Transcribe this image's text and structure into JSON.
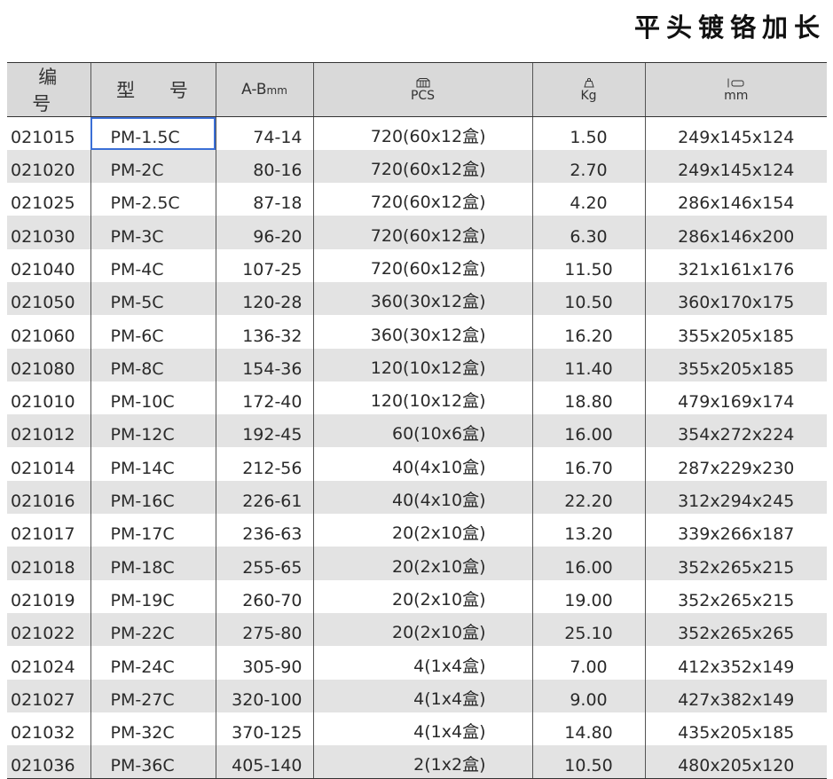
{
  "title": "平头镀铬加长",
  "headers": {
    "code": "编 号",
    "model": "型 号",
    "ab": "A-B",
    "ab_unit": "mm",
    "pcs_icon": "box-icon",
    "pcs": "PCS",
    "kg_icon": "weight-icon",
    "kg": "Kg",
    "mm_icon": "carton-dimension-icon",
    "mm": "mm"
  },
  "rows": [
    {
      "code": "021015",
      "model": "PM-1.5C",
      "ab": "74-14",
      "pcs": "720(60x12盒)",
      "kg": "1.50",
      "dim": "249x145x124"
    },
    {
      "code": "021020",
      "model": "PM-2C",
      "ab": "80-16",
      "pcs": "720(60x12盒)",
      "kg": "2.70",
      "dim": "249x145x124"
    },
    {
      "code": "021025",
      "model": "PM-2.5C",
      "ab": "87-18",
      "pcs": "720(60x12盒)",
      "kg": "4.20",
      "dim": "286x146x154"
    },
    {
      "code": "021030",
      "model": "PM-3C",
      "ab": "96-20",
      "pcs": "720(60x12盒)",
      "kg": "6.30",
      "dim": "286x146x200"
    },
    {
      "code": "021040",
      "model": "PM-4C",
      "ab": "107-25",
      "pcs": "720(60x12盒)",
      "kg": "11.50",
      "dim": "321x161x176"
    },
    {
      "code": "021050",
      "model": "PM-5C",
      "ab": "120-28",
      "pcs": "360(30x12盒)",
      "kg": "10.50",
      "dim": "360x170x175"
    },
    {
      "code": "021060",
      "model": "PM-6C",
      "ab": "136-32",
      "pcs": "360(30x12盒)",
      "kg": "16.20",
      "dim": "355x205x185"
    },
    {
      "code": "021080",
      "model": "PM-8C",
      "ab": "154-36",
      "pcs": "120(10x12盒)",
      "kg": "11.40",
      "dim": "355x205x185"
    },
    {
      "code": "021010",
      "model": "PM-10C",
      "ab": "172-40",
      "pcs": "120(10x12盒)",
      "kg": "18.80",
      "dim": "479x169x174"
    },
    {
      "code": "021012",
      "model": "PM-12C",
      "ab": "192-45",
      "pcs": "60(10x6盒)",
      "kg": "16.00",
      "dim": "354x272x224"
    },
    {
      "code": "021014",
      "model": "PM-14C",
      "ab": "212-56",
      "pcs": "40(4x10盒)",
      "kg": "16.70",
      "dim": "287x229x230"
    },
    {
      "code": "021016",
      "model": "PM-16C",
      "ab": "226-61",
      "pcs": "40(4x10盒)",
      "kg": "22.20",
      "dim": "312x294x245"
    },
    {
      "code": "021017",
      "model": "PM-17C",
      "ab": "236-63",
      "pcs": "20(2x10盒)",
      "kg": "13.20",
      "dim": "339x266x187"
    },
    {
      "code": "021018",
      "model": "PM-18C",
      "ab": "255-65",
      "pcs": "20(2x10盒)",
      "kg": "16.00",
      "dim": "352x265x215"
    },
    {
      "code": "021019",
      "model": "PM-19C",
      "ab": "260-70",
      "pcs": "20(2x10盒)",
      "kg": "19.00",
      "dim": "352x265x215"
    },
    {
      "code": "021022",
      "model": "PM-22C",
      "ab": "275-80",
      "pcs": "20(2x10盒)",
      "kg": "25.10",
      "dim": "352x265x265"
    },
    {
      "code": "021024",
      "model": "PM-24C",
      "ab": "305-90",
      "pcs": "4(1x4盒)",
      "kg": "7.00",
      "dim": "412x352x149"
    },
    {
      "code": "021027",
      "model": "PM-27C",
      "ab": "320-100",
      "pcs": "4(1x4盒)",
      "kg": "9.00",
      "dim": "427x382x149"
    },
    {
      "code": "021032",
      "model": "PM-32C",
      "ab": "370-125",
      "pcs": "4(1x4盒)",
      "kg": "14.80",
      "dim": "435x205x185"
    },
    {
      "code": "021036",
      "model": "PM-36C",
      "ab": "405-140",
      "pcs": "2(1x2盒)",
      "kg": "10.50",
      "dim": "480x205x120"
    }
  ]
}
